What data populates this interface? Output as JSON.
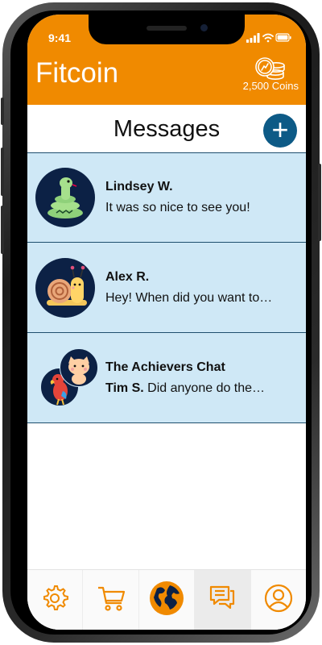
{
  "status": {
    "time": "9:41"
  },
  "header": {
    "app_title": "Fitcoin",
    "coins": "2,500 Coins"
  },
  "page": {
    "title": "Messages",
    "add_icon": "plus-icon"
  },
  "messages": [
    {
      "name": "Lindsey W.",
      "sender": "",
      "preview": "It was so nice to see you!",
      "avatar": "snake-avatar"
    },
    {
      "name": "Alex R.",
      "sender": "",
      "preview": "Hey! When did you want to…",
      "avatar": "snail-avatar"
    },
    {
      "name": "The Achievers Chat",
      "sender": "Tim S.",
      "preview": "Did anyone do the…",
      "avatar": "group-avatar"
    }
  ],
  "tabs": [
    {
      "icon": "gear-icon",
      "active": false
    },
    {
      "icon": "cart-icon",
      "active": false
    },
    {
      "icon": "globe-icon",
      "active": false
    },
    {
      "icon": "chat-icon",
      "active": true
    },
    {
      "icon": "profile-icon",
      "active": false
    }
  ],
  "colors": {
    "brand": "#f08a00",
    "accent": "#0d5a86",
    "row": "#cfe8f6"
  }
}
